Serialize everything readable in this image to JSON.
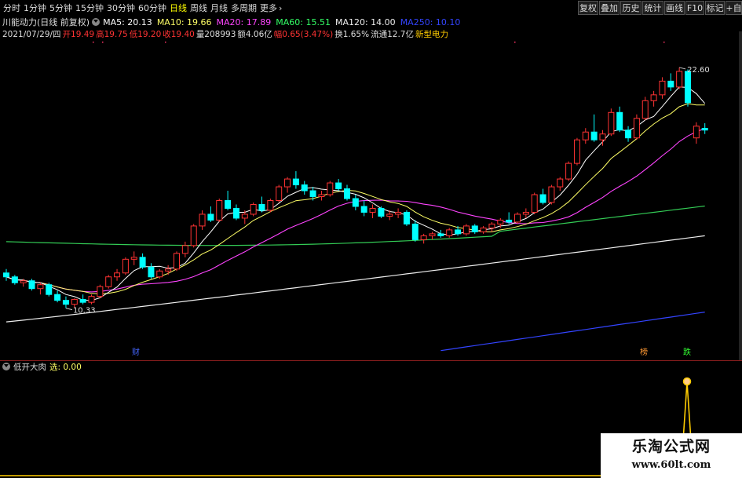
{
  "tabs": [
    {
      "label": "分时",
      "active": false
    },
    {
      "label": "1分钟",
      "active": false
    },
    {
      "label": "5分钟",
      "active": false
    },
    {
      "label": "15分钟",
      "active": false
    },
    {
      "label": "30分钟",
      "active": false
    },
    {
      "label": "60分钟",
      "active": false
    },
    {
      "label": "日线",
      "active": true
    },
    {
      "label": "周线",
      "active": false
    },
    {
      "label": "月线",
      "active": false
    },
    {
      "label": "多周期",
      "active": false
    },
    {
      "label": "更多",
      "active": false,
      "chevron": "›"
    }
  ],
  "toolbar": [
    "复权",
    "叠加",
    "历史",
    "统计",
    "画线",
    "F10",
    "标记",
    "+自"
  ],
  "info1": {
    "title": "川能动力(日线 前复权)",
    "ma": [
      {
        "text": "MA5: 20.13",
        "color": "#ffffff"
      },
      {
        "text": "MA10: 19.66",
        "color": "#ffff66"
      },
      {
        "text": "MA20: 17.89",
        "color": "#ff44ff"
      },
      {
        "text": "MA60: 15.51",
        "color": "#33ff66"
      },
      {
        "text": "MA120: 14.00",
        "color": "#eeeeee"
      },
      {
        "text": "MA250: 10.10",
        "color": "#3344ff"
      }
    ]
  },
  "info2": [
    {
      "text": "2021/07/29/四",
      "color": "#dddddd"
    },
    {
      "text": "开19.49",
      "color": "#ff3333"
    },
    {
      "text": "高19.75",
      "color": "#ff3333"
    },
    {
      "text": "低19.20",
      "color": "#ff3333"
    },
    {
      "text": "收19.40",
      "color": "#ff3333"
    },
    {
      "text": "量208993",
      "color": "#dddddd"
    },
    {
      "text": "额4.06亿",
      "color": "#dddddd"
    },
    {
      "text": "幅0.65(3.47%)",
      "color": "#ff3333"
    },
    {
      "text": "换1.65%",
      "color": "#dddddd"
    },
    {
      "text": "流通12.7亿",
      "color": "#dddddd"
    },
    {
      "text": "新型电力",
      "color": "#ffcc00"
    }
  ],
  "chart_labels": {
    "high_label": "22.60",
    "low_label": "10.33",
    "markers": [
      {
        "text": "财",
        "color": "#4466ff"
      },
      {
        "text": "榜",
        "color": "#ff9933"
      },
      {
        "text": "跌",
        "color": "#33ff33"
      }
    ]
  },
  "sub_info": {
    "title": "低开大肉",
    "label": "选: 0.00"
  },
  "watermark": {
    "line1": "乐淘公式网",
    "line2": "www.60lt.com"
  },
  "colors": {
    "up": "#ff3333",
    "down": "#00ffff",
    "bg": "#000000",
    "divider": "#8a1e1e",
    "signal": "#ffcc00"
  },
  "chart_data": {
    "type": "candlestick",
    "period": "daily",
    "high_label": 22.6,
    "low_label": 10.33,
    "ohlc": [
      [
        12.1,
        12.3,
        11.7,
        11.9
      ],
      [
        11.9,
        12.0,
        11.5,
        11.6
      ],
      [
        11.6,
        11.8,
        11.4,
        11.7
      ],
      [
        11.7,
        11.8,
        11.2,
        11.3
      ],
      [
        11.3,
        11.6,
        11.0,
        11.5
      ],
      [
        11.5,
        11.6,
        10.9,
        11.0
      ],
      [
        11.0,
        11.2,
        10.6,
        10.7
      ],
      [
        10.7,
        10.9,
        10.3,
        10.5
      ],
      [
        10.5,
        10.8,
        10.33,
        10.75
      ],
      [
        10.75,
        11.0,
        10.5,
        10.6
      ],
      [
        10.6,
        11.0,
        10.5,
        10.9
      ],
      [
        10.9,
        11.5,
        10.8,
        11.4
      ],
      [
        11.4,
        12.0,
        11.3,
        11.9
      ],
      [
        11.9,
        12.3,
        11.7,
        12.1
      ],
      [
        12.1,
        12.9,
        12.0,
        12.8
      ],
      [
        12.8,
        13.2,
        12.5,
        12.9
      ],
      [
        12.9,
        13.1,
        12.3,
        12.4
      ],
      [
        12.4,
        12.6,
        11.8,
        11.9
      ],
      [
        11.9,
        12.3,
        11.8,
        12.2
      ],
      [
        12.2,
        12.5,
        12.0,
        12.3
      ],
      [
        12.3,
        13.2,
        12.2,
        13.1
      ],
      [
        13.1,
        13.7,
        12.9,
        13.5
      ],
      [
        13.5,
        14.6,
        13.4,
        14.5
      ],
      [
        14.5,
        15.3,
        14.3,
        15.1
      ],
      [
        15.1,
        15.5,
        14.7,
        14.8
      ],
      [
        14.8,
        15.9,
        14.7,
        15.8
      ],
      [
        15.8,
        16.3,
        15.3,
        15.4
      ],
      [
        15.4,
        15.6,
        14.8,
        14.9
      ],
      [
        14.9,
        15.3,
        14.6,
        15.1
      ],
      [
        15.1,
        15.7,
        15.0,
        15.6
      ],
      [
        15.6,
        16.0,
        15.2,
        15.3
      ],
      [
        15.3,
        15.9,
        15.2,
        15.8
      ],
      [
        15.8,
        16.6,
        15.7,
        16.5
      ],
      [
        16.5,
        17.0,
        16.2,
        16.9
      ],
      [
        16.9,
        17.3,
        16.4,
        16.6
      ],
      [
        16.6,
        16.8,
        16.1,
        16.3
      ],
      [
        16.3,
        16.5,
        15.8,
        16.0
      ],
      [
        16.0,
        16.3,
        15.8,
        16.1
      ],
      [
        16.1,
        16.8,
        16.0,
        16.7
      ],
      [
        16.7,
        16.9,
        16.3,
        16.4
      ],
      [
        16.4,
        16.6,
        15.8,
        15.9
      ],
      [
        15.9,
        16.1,
        15.3,
        15.5
      ],
      [
        15.5,
        15.8,
        15.0,
        15.2
      ],
      [
        15.2,
        15.6,
        14.9,
        15.4
      ],
      [
        15.4,
        15.5,
        14.9,
        15.0
      ],
      [
        15.0,
        15.3,
        14.8,
        15.1
      ],
      [
        15.1,
        15.4,
        14.9,
        15.2
      ],
      [
        15.2,
        15.3,
        14.5,
        14.6
      ],
      [
        14.6,
        14.8,
        13.7,
        13.8
      ],
      [
        13.8,
        14.1,
        13.6,
        14.0
      ],
      [
        14.0,
        14.2,
        13.8,
        14.1
      ],
      [
        14.1,
        14.3,
        13.9,
        14.0
      ],
      [
        14.0,
        14.4,
        13.9,
        14.3
      ],
      [
        14.3,
        14.5,
        14.0,
        14.1
      ],
      [
        14.1,
        14.6,
        14.0,
        14.5
      ],
      [
        14.5,
        14.6,
        14.1,
        14.2
      ],
      [
        14.2,
        14.5,
        14.1,
        14.4
      ],
      [
        14.4,
        14.7,
        14.2,
        14.6
      ],
      [
        14.6,
        14.9,
        14.4,
        14.8
      ],
      [
        14.8,
        15.2,
        14.6,
        14.7
      ],
      [
        14.7,
        15.2,
        14.6,
        15.1
      ],
      [
        15.1,
        15.4,
        14.9,
        15.2
      ],
      [
        15.2,
        16.2,
        15.1,
        16.1
      ],
      [
        16.1,
        16.4,
        15.6,
        15.7
      ],
      [
        15.7,
        16.6,
        15.6,
        16.5
      ],
      [
        16.5,
        17.0,
        16.3,
        16.9
      ],
      [
        16.9,
        17.8,
        16.8,
        17.7
      ],
      [
        17.7,
        19.0,
        17.6,
        18.9
      ],
      [
        18.9,
        19.5,
        18.7,
        19.3
      ],
      [
        19.3,
        20.2,
        18.8,
        18.9
      ],
      [
        18.9,
        19.4,
        18.6,
        19.2
      ],
      [
        19.2,
        20.5,
        19.1,
        20.3
      ],
      [
        20.3,
        20.6,
        19.3,
        19.4
      ],
      [
        19.4,
        19.6,
        18.8,
        19.0
      ],
      [
        19.0,
        20.2,
        18.9,
        20.0
      ],
      [
        20.0,
        21.1,
        19.9,
        20.9
      ],
      [
        20.9,
        21.4,
        20.6,
        21.2
      ],
      [
        21.2,
        22.1,
        21.0,
        21.9
      ],
      [
        21.9,
        22.3,
        21.4,
        21.6
      ],
      [
        21.6,
        22.6,
        21.5,
        22.4
      ],
      [
        22.4,
        22.5,
        20.6,
        20.8
      ],
      [
        19.0,
        19.8,
        18.7,
        19.6
      ],
      [
        19.49,
        19.75,
        19.2,
        19.4
      ]
    ],
    "ma_last": {
      "MA5": 20.13,
      "MA10": 19.66,
      "MA20": 17.89,
      "MA60": 15.51,
      "MA120": 14.0,
      "MA250": 10.1
    },
    "indicator": {
      "name": "低开大肉",
      "value": 0.0,
      "signal_index": 80
    }
  }
}
